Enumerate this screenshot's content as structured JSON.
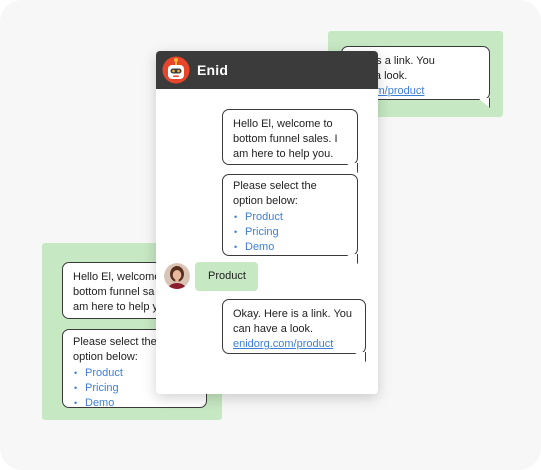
{
  "chat": {
    "bot_name": "Enid",
    "messages": {
      "welcome": "Hello El, welcome to bottom funnel sales. I am here to help you.",
      "welcome_lines": [
        "Hello El, welcome to",
        "bottom funnel sales. I",
        "am here to help you."
      ],
      "select_lines": [
        "Please select the",
        "option below:"
      ],
      "options": [
        "Product",
        "Pricing",
        "Demo"
      ],
      "user_reply": "Product",
      "link_lines": [
        "Okay. Here is a link. You",
        "can have a look."
      ],
      "link_text": "enidorg.com/product"
    }
  },
  "background_cards": {
    "top": {
      "lines": [
        "Okay. Here is a link. You",
        "can have a look."
      ],
      "visible_lines": [
        "y. Here is a link. You",
        "have a look."
      ],
      "link_text": "orgcom/product"
    },
    "bottom": {
      "welcome_visible_lines": [
        "Hello El, welcome",
        "bottom funnel sa",
        "am here to help y"
      ],
      "select_visible_lines": [
        "Please select the",
        "option below:"
      ],
      "options": [
        "Product",
        "Pricing",
        "Demo"
      ]
    }
  },
  "colors": {
    "header_bg": "#3b3b3b",
    "green_card": "#c6e8c2",
    "link": "#3d7fd6",
    "canvas": "#f7f7f7"
  },
  "icons": {
    "bot_avatar": "robot-avatar-icon",
    "user_avatar": "user-avatar-icon"
  }
}
